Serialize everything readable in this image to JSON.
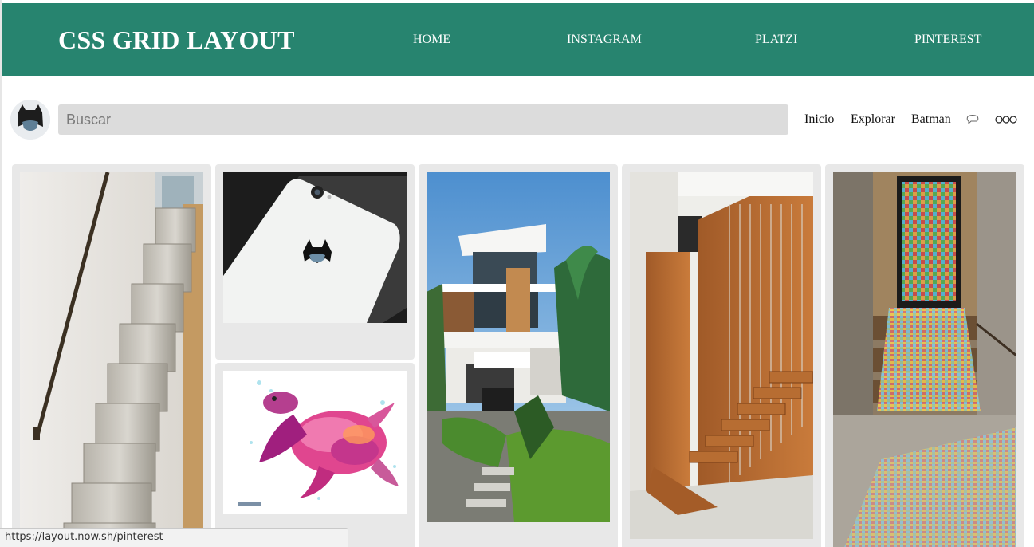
{
  "theme": {
    "brand": "#27846f"
  },
  "header": {
    "title": "CSS GRID LAYOUT",
    "nav": [
      "HOME",
      "INSTAGRAM",
      "PLATZI",
      "PINTEREST"
    ]
  },
  "subbar": {
    "avatar_icon": "batman-avatar-icon",
    "search_placeholder": "Buscar",
    "links": [
      "Inicio",
      "Explorar",
      "Batman"
    ],
    "icons": [
      "chat-icon",
      "more-icon"
    ]
  },
  "cards": [
    {
      "subject": "stairs-handrail-photo"
    },
    {
      "subject": "iphone-batman-logo-photo"
    },
    {
      "subject": "turtle-watercolor-image"
    },
    {
      "subject": "modern-house-photo"
    },
    {
      "subject": "wooden-staircase-photo"
    },
    {
      "subject": "stained-glass-stairs-photo"
    }
  ],
  "status": {
    "url": "https://layout.now.sh/pinterest"
  }
}
